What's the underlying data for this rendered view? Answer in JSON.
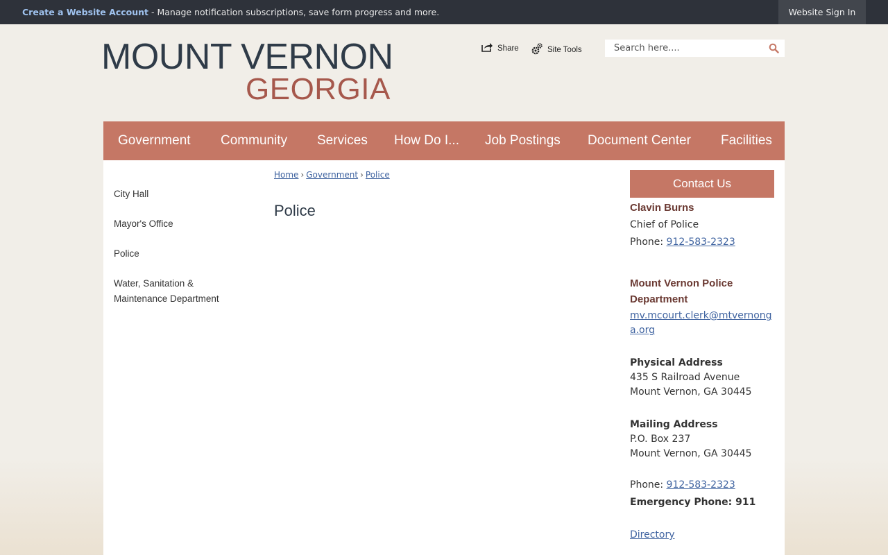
{
  "topbar": {
    "create_account_link": "Create a Website Account",
    "message": " - Manage notification subscriptions, save form progress and more.",
    "sign_in": "Website Sign In"
  },
  "header": {
    "logo_line1": "MOUNT VERNON",
    "logo_line2": "GEORGIA",
    "share_label": "Share",
    "site_tools_label": "Site Tools",
    "search_placeholder": "Search here...."
  },
  "nav": {
    "items": [
      "Government",
      "Community",
      "Services",
      "How Do I...",
      "Job Postings",
      "Document Center",
      "Facilities"
    ]
  },
  "sidebar": {
    "items": [
      "City Hall",
      "Mayor's Office",
      "Police",
      "Water, Sanitation & Maintenance Department"
    ]
  },
  "breadcrumb": {
    "items": [
      "Home",
      "Government",
      "Police"
    ],
    "separator": "›"
  },
  "page": {
    "title": "Police"
  },
  "contact": {
    "button": "Contact Us",
    "person_name": "Clavin Burns",
    "person_title": "Chief of Police",
    "phone_label": "Phone: ",
    "phone": "912-583-2323",
    "dept_name": "Mount Vernon Police Department",
    "email": "mv.mcourt.clerk@mtvernonga.org",
    "physical_heading": "Physical Address",
    "physical_line1": "435 S Railroad Avenue",
    "physical_line2": "Mount Vernon, GA 30445",
    "mailing_heading": "Mailing Address",
    "mailing_line1": "P.O. Box 237",
    "mailing_line2": "Mount Vernon, GA 30445",
    "phone2_label": "Phone: ",
    "phone2": "912-583-2323",
    "emergency": "Emergency Phone: 911",
    "directory": "Directory"
  },
  "colors": {
    "accent": "#c57765",
    "topbar": "#2e323a",
    "logo_dark": "#2f3b48",
    "logo_red": "#a6584c",
    "link": "#3f63a0"
  }
}
